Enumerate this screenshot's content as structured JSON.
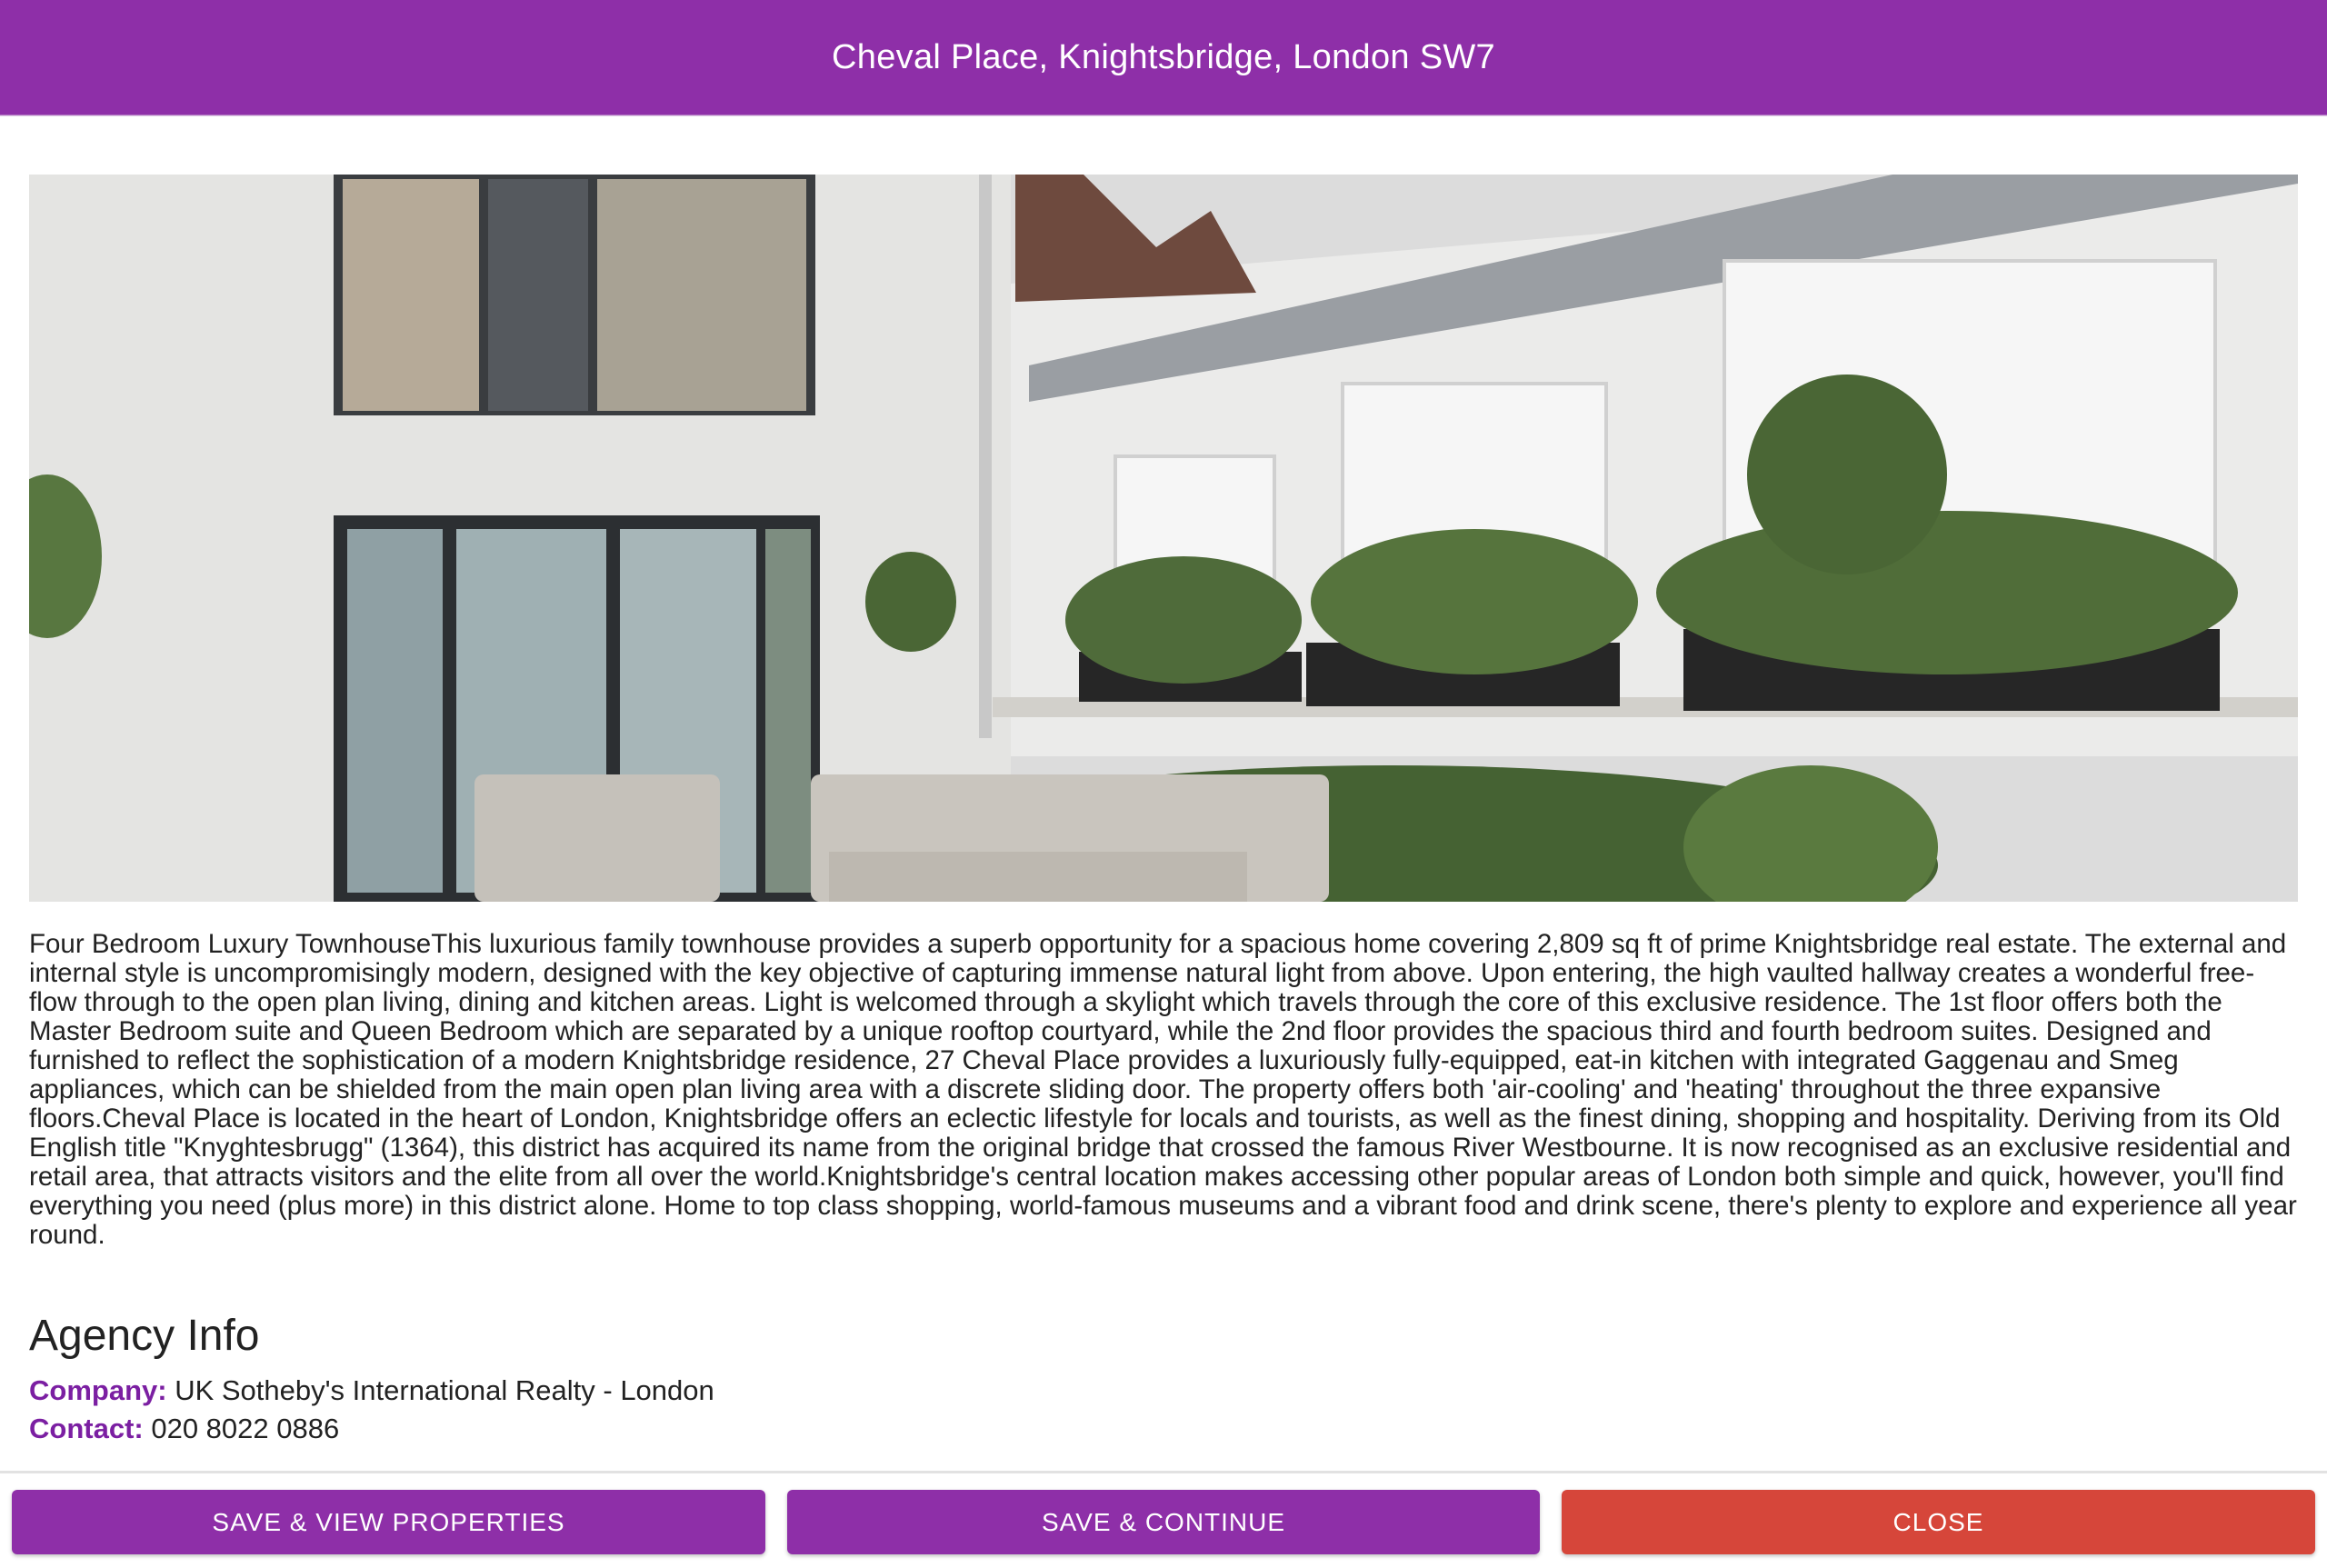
{
  "header": {
    "title": "Cheval Place, Knightsbridge, London SW7",
    "color": "#8e2fa8"
  },
  "listing": {
    "hero_image": {
      "icon": "courtyard-photo",
      "alt": "Courtyard terrace with planters and outdoor sofa"
    },
    "description": "Four Bedroom Luxury TownhouseThis luxurious family townhouse provides a superb opportunity for a spacious home covering 2,809 sq ft of prime Knightsbridge real estate. The external and internal style is uncompromisingly modern, designed with the key objective of capturing immense natural light from above. Upon entering, the high vaulted hallway creates a wonderful free-flow through to the open plan living, dining and kitchen areas. Light is welcomed through a skylight which travels through the core of this exclusive residence. The 1st floor offers both the Master Bedroom suite and Queen Bedroom which are separated by a unique rooftop courtyard, while the 2nd floor provides the spacious third and fourth bedroom suites. Designed and furnished to reflect the sophistication of a modern Knightsbridge residence, 27 Cheval Place provides a luxuriously fully-equipped, eat-in kitchen with integrated Gaggenau and Smeg appliances, which can be shielded from the main open plan living area with a discrete sliding door. The property offers both 'air-cooling' and 'heating' throughout the three expansive floors.Cheval Place is located in the heart of London, Knightsbridge offers an eclectic lifestyle for locals and tourists, as well as the finest dining, shopping and hospitality. Deriving from its Old English title \"Knyghtesbrugg\" (1364), this district has acquired its name from the original bridge that crossed the famous River Westbourne. It is now recognised as an exclusive residential and retail area, that attracts visitors and the elite from all over the world.Knightsbridge's central location makes accessing other popular areas of London both simple and quick, however, you'll find everything you need (plus more) in this district alone. Home to top class shopping, world-famous museums and a vibrant food and drink scene, there's plenty to explore and experience all year round."
  },
  "agency": {
    "heading": "Agency Info",
    "company_label": "Company:",
    "company": "UK Sotheby's International Realty - London",
    "contact_label": "Contact:",
    "contact": "020 8022 0886",
    "label_color": "#7b1fa2"
  },
  "actions": {
    "save_view": "SAVE & VIEW PROPERTIES",
    "save_continue": "SAVE & CONTINUE",
    "close": "CLOSE",
    "primary_color": "#8e2fa8",
    "close_color": "#d6463a"
  }
}
